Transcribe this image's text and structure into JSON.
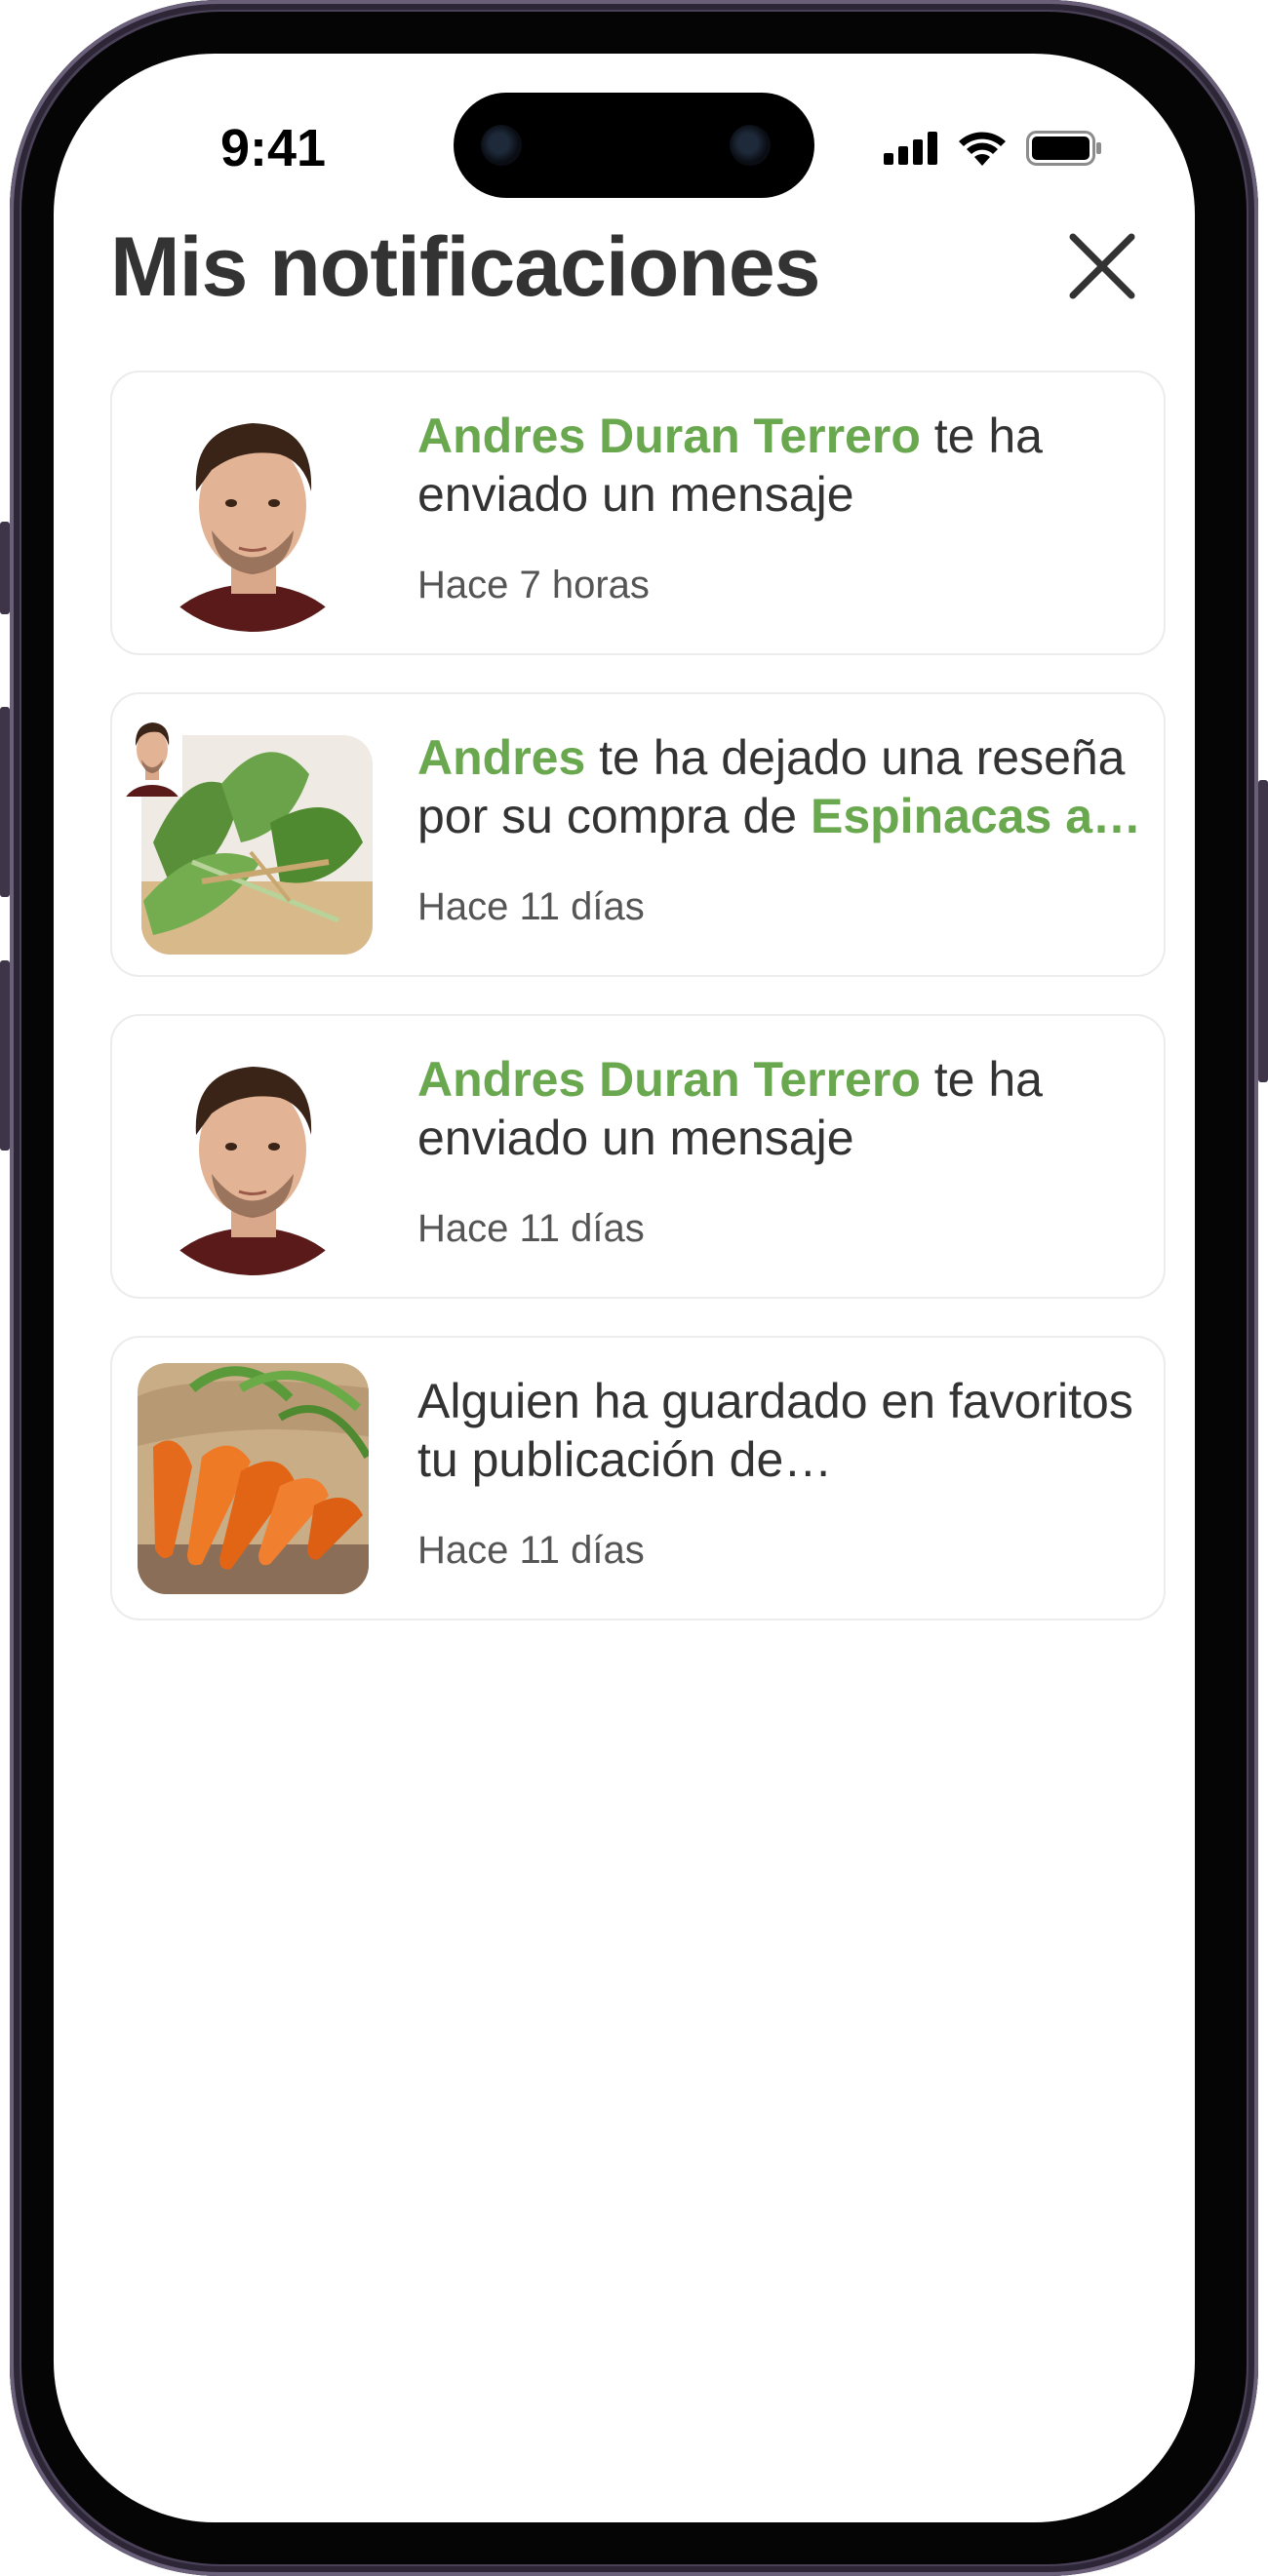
{
  "status_bar": {
    "time": "9:41"
  },
  "header": {
    "title": "Mis notificaciones",
    "close_icon": "close-icon"
  },
  "notifications": [
    {
      "image": "user-avatar",
      "highlight": "Andres Duran Terrero",
      "text_rest": " te ha enviado un mensaje",
      "time": "Hace 7 horas"
    },
    {
      "image": "spinach-product-photo",
      "highlight": "Andres",
      "text_mid": " te ha dejado una reseña por su compra de ",
      "highlight2": "Espinacas a…",
      "time": "Hace 11 días"
    },
    {
      "image": "user-avatar",
      "highlight": "Andres Duran Terrero",
      "text_rest": " te ha enviado un mensaje",
      "time": "Hace 11 días"
    },
    {
      "image": "carrots-product-photo",
      "text": "Alguien ha guardado en favoritos tu publicación de…",
      "time": "Hace 11 días"
    }
  ],
  "colors": {
    "accent": "#6aa84f",
    "title": "#333333",
    "card_border": "#ececec"
  }
}
